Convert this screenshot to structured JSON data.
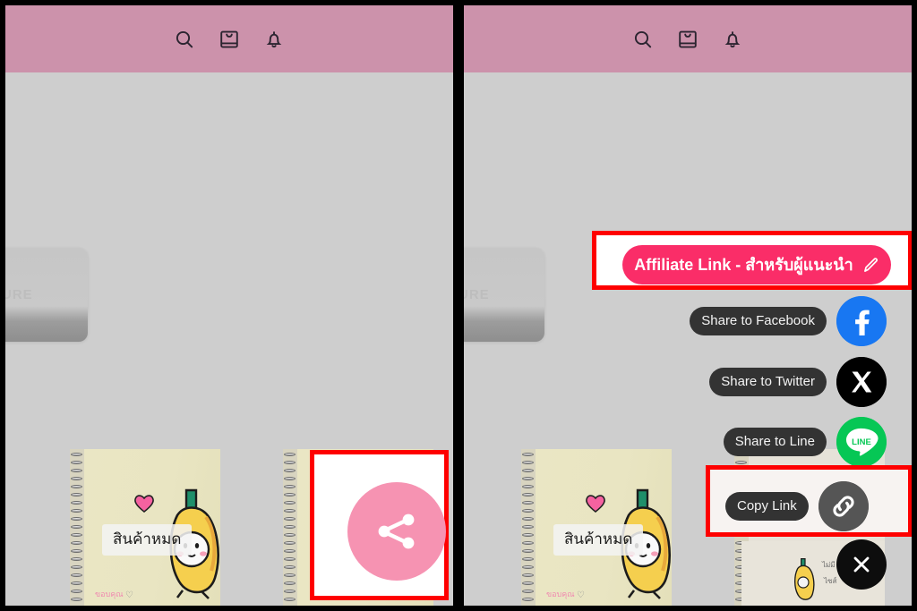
{
  "meta": {
    "screens": 2,
    "background_color": "#cecece",
    "header_color": "#cc92ab",
    "annotation_color": "#fe0000"
  },
  "header": {
    "icons": [
      {
        "name": "search-icon",
        "label": "Search"
      },
      {
        "name": "shop-bag-icon",
        "label": "Shop"
      },
      {
        "name": "bell-icon",
        "label": "Notifications"
      }
    ]
  },
  "picture_card": {
    "label": "CTURE",
    "full_label": "PICTURE"
  },
  "left_screen": {
    "share_fab": {
      "name": "share-fab",
      "icon": "share-nodes-icon",
      "color": "#f693b2"
    },
    "annotation": "share-fab-highlight"
  },
  "right_screen": {
    "affiliate_button": {
      "label": "Affiliate Link - สำหรับผู้แนะนำ",
      "icon": "pencil-icon",
      "color": "#fa2d68"
    },
    "share_options": [
      {
        "label": "Share to Facebook",
        "icon": "facebook-icon",
        "color": "#1877f2"
      },
      {
        "label": "Share to Twitter",
        "icon": "x-twitter-icon",
        "color": "#000000"
      },
      {
        "label": "Share to Line",
        "icon": "line-icon",
        "color": "#06c755",
        "badge_text": "LINE"
      },
      {
        "label": "Copy Link",
        "icon": "link-chain-icon",
        "color": "#555555"
      }
    ],
    "close_button": {
      "label": "Close",
      "icon": "close-x-icon",
      "color": "#0d0d0d"
    },
    "annotations": [
      "affiliate-link-highlight",
      "copy-link-highlight"
    ]
  },
  "products": {
    "out_of_stock_label": "สินค้าหมด",
    "scribble": "ขอบคุณ",
    "items": [
      {
        "name": "notebook-banana-1",
        "status": "สินค้าหมด"
      },
      {
        "name": "notebook-banana-2",
        "status": "สินค้าหมด"
      }
    ]
  }
}
